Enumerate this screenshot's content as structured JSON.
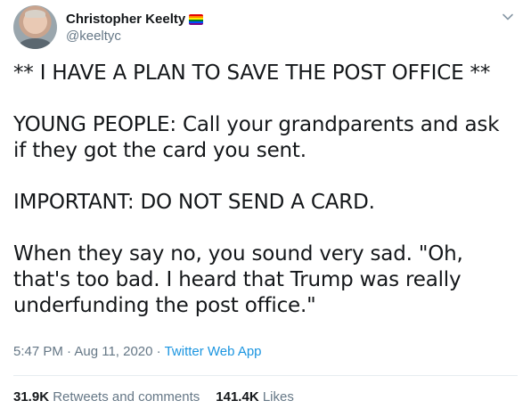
{
  "author": {
    "display_name": "Christopher Keelty",
    "handle": "@keeltyc"
  },
  "icons": {
    "flag": "rainbow-flag-icon",
    "menu": "chevron-down-icon"
  },
  "colors": {
    "link": "#1b95e0",
    "secondary_text": "#657786",
    "primary_text": "#14171a",
    "flag_stripes": [
      "#e40303",
      "#ff8c00",
      "#ffed00",
      "#008026",
      "#004dff",
      "#750787"
    ]
  },
  "tweet": {
    "text": "** I HAVE A PLAN TO SAVE THE POST OFFICE **\n\nYOUNG PEOPLE: Call your grandparents and ask if they got the card you sent.\n\nIMPORTANT: DO NOT SEND A CARD.\n\nWhen they say no, you sound very sad. \"Oh, that's too bad. I heard that Trump was really underfunding the post office.\""
  },
  "meta": {
    "timestamp": "5:47 PM · Aug 11, 2020",
    "separator": " · ",
    "source": "Twitter Web App"
  },
  "stats": {
    "retweets_count": "31.9K",
    "retweets_label": " Retweets and comments",
    "likes_count": "141.4K",
    "likes_label": " Likes"
  }
}
